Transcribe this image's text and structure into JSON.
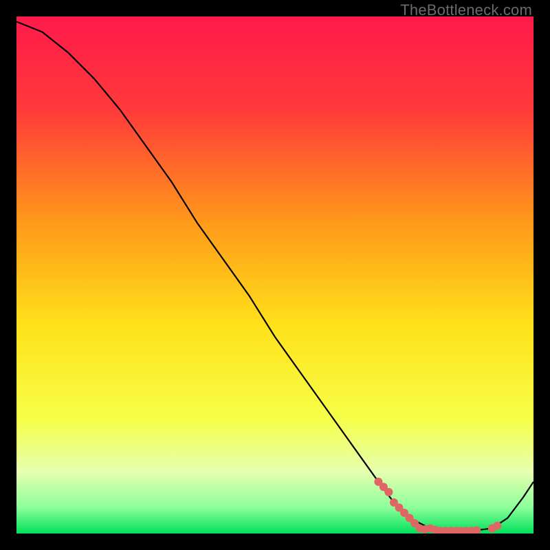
{
  "watermark": "TheBottleneck.com",
  "chart_data": {
    "type": "line",
    "title": "",
    "xlabel": "",
    "ylabel": "",
    "xlim": [
      0,
      100
    ],
    "ylim": [
      0,
      100
    ],
    "grid": false,
    "legend": false,
    "main_curve": {
      "name": "bottleneck-curve",
      "x": [
        0,
        5,
        10,
        15,
        20,
        25,
        30,
        35,
        40,
        45,
        50,
        55,
        60,
        65,
        70,
        73,
        76,
        80,
        84,
        88,
        92,
        95,
        98,
        100
      ],
      "y": [
        99,
        97,
        93,
        88,
        82,
        75,
        68,
        60,
        53,
        46,
        38,
        31,
        24,
        17,
        10,
        6,
        3,
        1,
        0.5,
        0.5,
        1,
        3,
        7,
        10
      ]
    },
    "highlight_points": {
      "name": "optimal-range-points",
      "color": "#e06666",
      "x": [
        70,
        71,
        72,
        73,
        74,
        75,
        76,
        77,
        78,
        79,
        80,
        81,
        82,
        83,
        84,
        85,
        86,
        87,
        88,
        89,
        92,
        93
      ],
      "y": [
        10,
        9,
        8,
        6,
        5,
        4,
        3,
        2,
        1,
        0.8,
        1,
        0.7,
        0.5,
        0.5,
        0.5,
        0.5,
        0.5,
        0.5,
        0.5,
        0.6,
        1,
        1.5
      ]
    },
    "background_gradient": {
      "stops": [
        {
          "offset": 0.0,
          "color": "#ff1a4b"
        },
        {
          "offset": 0.18,
          "color": "#ff3a3a"
        },
        {
          "offset": 0.4,
          "color": "#ff9a1a"
        },
        {
          "offset": 0.6,
          "color": "#ffe21a"
        },
        {
          "offset": 0.78,
          "color": "#f6ff4a"
        },
        {
          "offset": 0.88,
          "color": "#e6ffb0"
        },
        {
          "offset": 0.95,
          "color": "#8cff9a"
        },
        {
          "offset": 1.0,
          "color": "#00e05a"
        }
      ]
    }
  }
}
